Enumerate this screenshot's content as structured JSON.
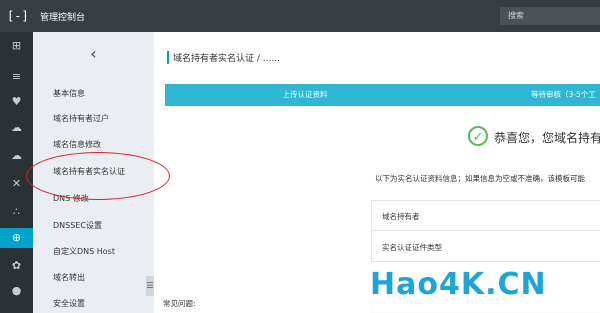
{
  "header": {
    "logo_glyph": "[-]",
    "app_title": "管理控制台",
    "search_placeholder": "搜索"
  },
  "iconbar": {
    "icons": [
      "grid-icon",
      "list-icon",
      "shield-icon",
      "cloud-icon",
      "cloud-upload-icon",
      "network-icon",
      "nodes-icon",
      "globe-icon",
      "settings-icon",
      "circle-icon"
    ]
  },
  "sidebar": {
    "collapse_glyph": "‹",
    "items": [
      {
        "label": "基本信息"
      },
      {
        "label": "域名持有者过户"
      },
      {
        "label": "域名信息修改"
      },
      {
        "label": "域名持有者实名认证"
      },
      {
        "label": "DNS 修改"
      },
      {
        "label": "DNSSEC设置"
      },
      {
        "label": "自定义DNS Host"
      },
      {
        "label": "域名转出"
      },
      {
        "label": "安全设置"
      }
    ],
    "fold_glyph": "☰"
  },
  "main": {
    "page_title": "域名持有者实名认证 / ......",
    "steps": [
      {
        "label": "上传认证资料"
      },
      {
        "label": "等待审核（3-5个工"
      }
    ],
    "success_text": "恭喜您，您域名持有",
    "info_text": "以下为实名认证资料信息；如果信息为空或不准确，该模板可能",
    "table_rows": [
      {
        "label": "域名持有者"
      },
      {
        "label": "实名认证证件类型"
      }
    ],
    "faq_label": "常见问题:"
  },
  "watermark": {
    "text": "Hao4K.CN"
  },
  "colors": {
    "accent": "#00a2ca",
    "step": "#2fb6d2",
    "success": "#5cb85c",
    "highlight": "#d9242c",
    "topbar": "#373d41"
  }
}
